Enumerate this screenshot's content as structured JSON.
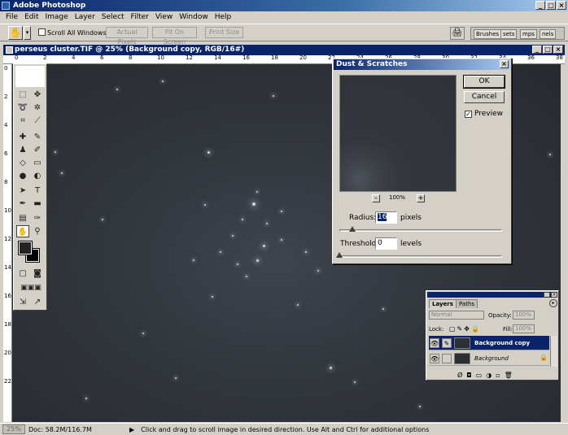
{
  "app": {
    "title": "Adobe Photoshop",
    "win_min": "_",
    "win_max": "□",
    "win_close": "×"
  },
  "menu": [
    "File",
    "Edit",
    "Image",
    "Layer",
    "Select",
    "Filter",
    "View",
    "Window",
    "Help"
  ],
  "options": {
    "scroll_all_label": "Scroll All Windows",
    "actual_pixels": "Actual Pixels",
    "fit_on_screen": "Fit On Screen",
    "print_size": "Print Size"
  },
  "palette_well": {
    "tabs": [
      "Brushes",
      "sets",
      "mps",
      "nels"
    ]
  },
  "document": {
    "title": "perseus cluster.TIF @ 25% (Background copy, RGB/16#)",
    "ruler_h": [
      "0",
      "2",
      "4",
      "6",
      "8",
      "10",
      "12",
      "14",
      "16",
      "18",
      "20",
      "22",
      "24",
      "26",
      "28",
      "30",
      "32",
      "34",
      "36",
      "38"
    ],
    "ruler_v": [
      "0",
      "2",
      "4",
      "6",
      "8",
      "10",
      "12",
      "14",
      "16",
      "18",
      "20",
      "22"
    ]
  },
  "dialog": {
    "title": "Dust & Scratches",
    "ok": "OK",
    "cancel": "Cancel",
    "preview_label": "Preview",
    "preview_checked": "✓",
    "zoom_minus": "-",
    "zoom_plus": "+",
    "zoom": "100%",
    "radius_label": "Radius:",
    "radius_value": "16",
    "radius_unit": "pixels",
    "radius_level": 0.08,
    "threshold_label": "Threshold:",
    "threshold_value": "0",
    "threshold_unit": "levels",
    "threshold_level": 0
  },
  "layers_palette": {
    "tab_layers": "Layers",
    "tab_paths": "Paths",
    "blend_mode": "Normal",
    "opacity_label": "Opacity:",
    "opacity_value": "100%",
    "lock_label": "Lock:",
    "fill_label": "Fill:",
    "fill_value": "100%",
    "layers": [
      {
        "name": "Background copy"
      },
      {
        "name": "Background"
      }
    ]
  },
  "status": {
    "zoom": "25%",
    "doc": "Doc: 58.2M/116.7M",
    "hint": "Click and drag to scroll image in desired direction.  Use Alt and Ctrl for additional options"
  }
}
